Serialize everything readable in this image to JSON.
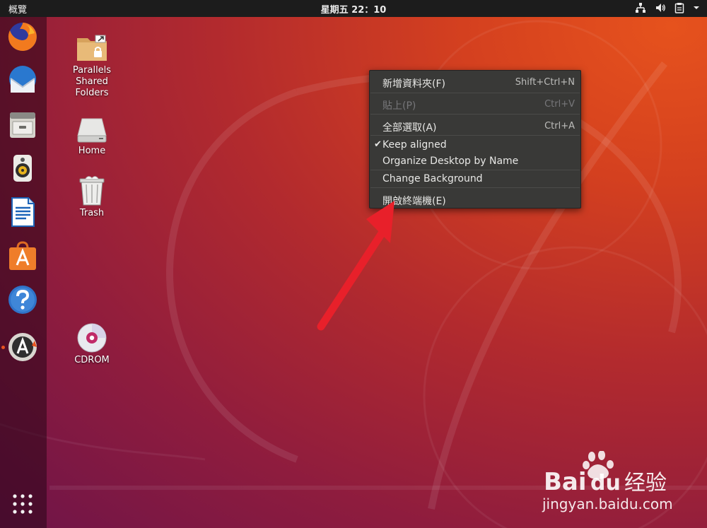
{
  "topbar": {
    "activities": "概覽",
    "clock": "星期五 22：10"
  },
  "dock": {
    "items": [
      {
        "name": "firefox",
        "icon": "firefox-icon"
      },
      {
        "name": "thunderbird",
        "icon": "thunderbird-mail-icon"
      },
      {
        "name": "files",
        "icon": "file-cabinet-icon"
      },
      {
        "name": "rhythmbox",
        "icon": "speaker-icon"
      },
      {
        "name": "libreoffice-writer",
        "icon": "document-icon"
      },
      {
        "name": "ubuntu-software",
        "icon": "software-bag-icon"
      },
      {
        "name": "help",
        "icon": "question-mark-icon"
      },
      {
        "name": "software-updater",
        "icon": "updater-icon"
      }
    ],
    "show_apps": "grid-icon"
  },
  "desktop": {
    "icons": [
      {
        "label": "Parallels\nShared\nFolders",
        "icon": "shared-folder-icon"
      },
      {
        "label": "Home",
        "icon": "drive-icon"
      },
      {
        "label": "Trash",
        "icon": "trash-icon"
      },
      {
        "label": "CDROM",
        "icon": "cd-icon"
      }
    ]
  },
  "context_menu": {
    "items": [
      {
        "label": "新增資料夾(F)",
        "shortcut": "Shift+Ctrl+N",
        "enabled": true
      },
      {
        "label": "貼上(P)",
        "shortcut": "Ctrl+V",
        "enabled": false
      },
      {
        "label": "全部選取(A)",
        "shortcut": "Ctrl+A",
        "enabled": true
      },
      {
        "label": "Keep aligned",
        "shortcut": "",
        "enabled": true,
        "checked": true
      },
      {
        "label": "Organize Desktop by Name",
        "shortcut": "",
        "enabled": true
      },
      {
        "label": "Change Background",
        "shortcut": "",
        "enabled": true
      },
      {
        "label": "開啟終端機(E)",
        "shortcut": "",
        "enabled": true
      }
    ],
    "check_mark": "✔"
  },
  "watermark": {
    "brand": "Bai",
    "brand_suffix": "du",
    "product": "经验",
    "url": "jingyan.baidu.com"
  },
  "colors": {
    "accent": "#e95420",
    "menu_bg": "#393937",
    "arrow": "#e8202a"
  }
}
